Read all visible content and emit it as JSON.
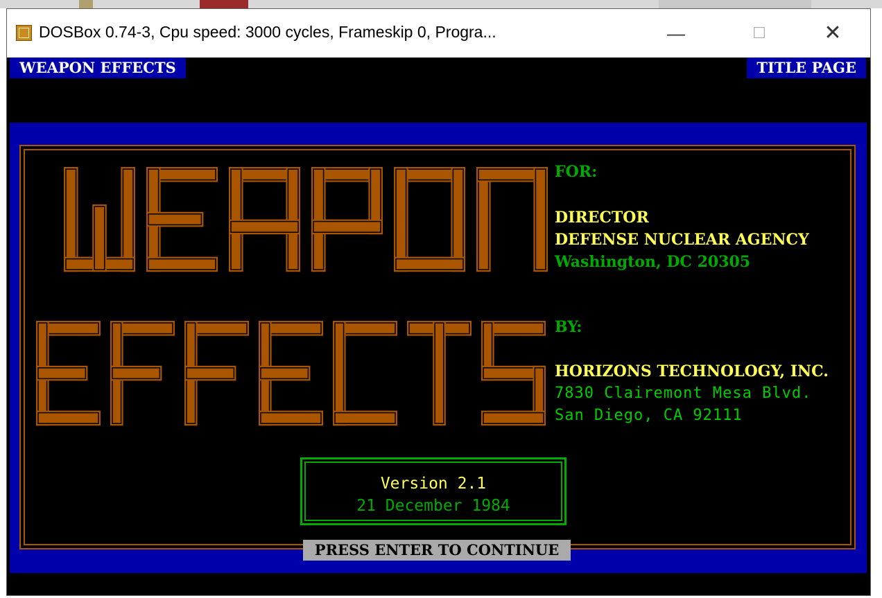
{
  "window": {
    "title": "DOSBox 0.74-3, Cpu speed:     3000 cycles, Frameskip  0, Progra...",
    "icon": "dosbox-icon",
    "minimize_glyph": "—",
    "maximize_glyph": "☐",
    "close_glyph": "✕"
  },
  "header": {
    "left_tag": "WEAPON EFFECTS",
    "right_tag": "TITLE PAGE"
  },
  "logo": {
    "line1": "WEAPON",
    "line2": "EFFECTS",
    "color": "#aa5500"
  },
  "info": {
    "for_label": "FOR:",
    "for_title": "DIRECTOR",
    "for_agency": "DEFENSE NUCLEAR AGENCY",
    "for_address": "Washington, DC 20305",
    "by_label": "BY:",
    "by_company": "HORIZONS TECHNOLOGY, INC.",
    "by_street": "7830 Clairemont Mesa Blvd.",
    "by_city": "San Diego, CA 92111"
  },
  "version": {
    "label": "Version 2.1",
    "date": "21 December 1984"
  },
  "prompt": "PRESS ENTER TO CONTINUE",
  "colors": {
    "blue": "#0000aa",
    "orange": "#aa5500",
    "green": "#00aa00",
    "yellow": "#ffff55",
    "gray": "#aaaaaa"
  }
}
